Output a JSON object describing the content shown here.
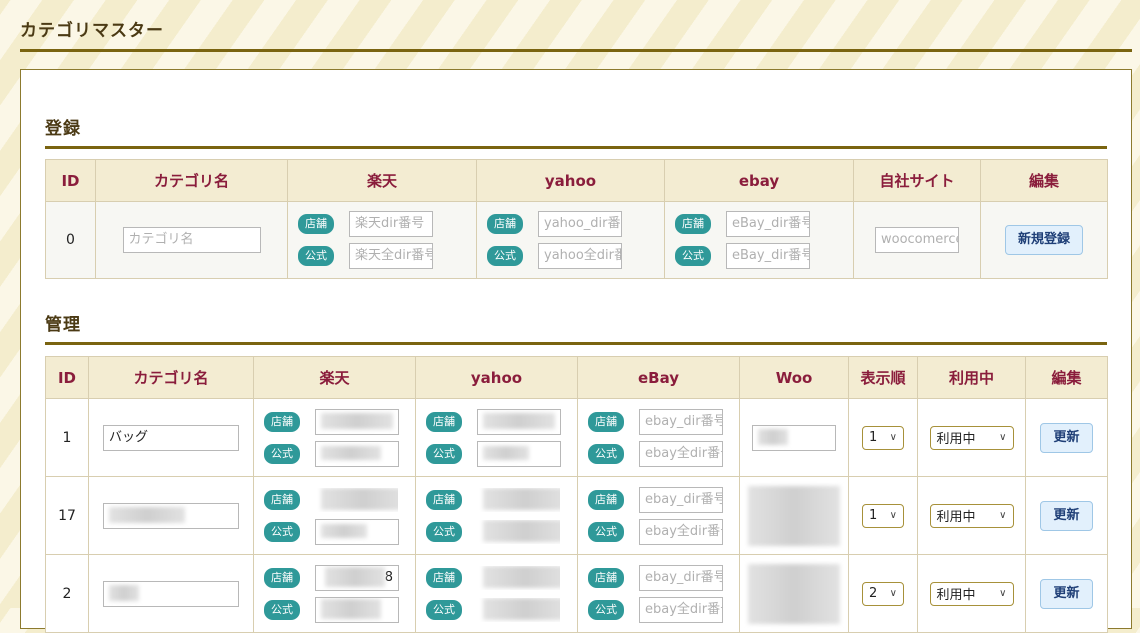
{
  "page": {
    "title": "カテゴリマスター"
  },
  "register": {
    "heading": "登録",
    "headers": [
      "ID",
      "カテゴリ名",
      "楽天",
      "yahoo",
      "ebay",
      "自社サイト",
      "編集"
    ],
    "row": {
      "id": "0",
      "name_placeholder": "カテゴリ名",
      "rakuten": {
        "shop_badge": "店舗",
        "shop_placeholder": "楽天dir番号",
        "official_badge": "公式",
        "official_placeholder": "楽天全dir番号"
      },
      "yahoo": {
        "shop_badge": "店舗",
        "shop_placeholder": "yahoo_dir番号",
        "official_badge": "公式",
        "official_placeholder": "yahoo全dir番号"
      },
      "ebay": {
        "shop_badge": "店舗",
        "shop_placeholder": "eBay_dir番号",
        "official_badge": "公式",
        "official_placeholder": "eBay_dir番号"
      },
      "woo_placeholder": "woocomerce",
      "button": "新規登録"
    }
  },
  "manage": {
    "heading": "管理",
    "headers": [
      "ID",
      "カテゴリ名",
      "楽天",
      "yahoo",
      "eBay",
      "Woo",
      "表示順",
      "利用中",
      "編集"
    ],
    "badge_shop": "店舗",
    "badge_official": "公式",
    "ebay_shop_placeholder": "ebay_dir番号",
    "ebay_official_placeholder": "ebay全dir番号",
    "rows": [
      {
        "id": "1",
        "name": "バッグ",
        "order": "1",
        "status": "利用中",
        "button": "更新"
      },
      {
        "id": "17",
        "name": "",
        "order": "1",
        "status": "利用中",
        "button": "更新"
      },
      {
        "id": "2",
        "name": "",
        "order": "2",
        "status": "利用中",
        "button": "更新",
        "rakuten_shop_partial": "8"
      }
    ]
  },
  "icons": {
    "select_chevron": "chevron-down-icon"
  },
  "colors": {
    "accent": "#7a6410",
    "header_text": "#8a1d3c",
    "badge": "#2f9999",
    "button_bg": "#e2f0fc"
  }
}
